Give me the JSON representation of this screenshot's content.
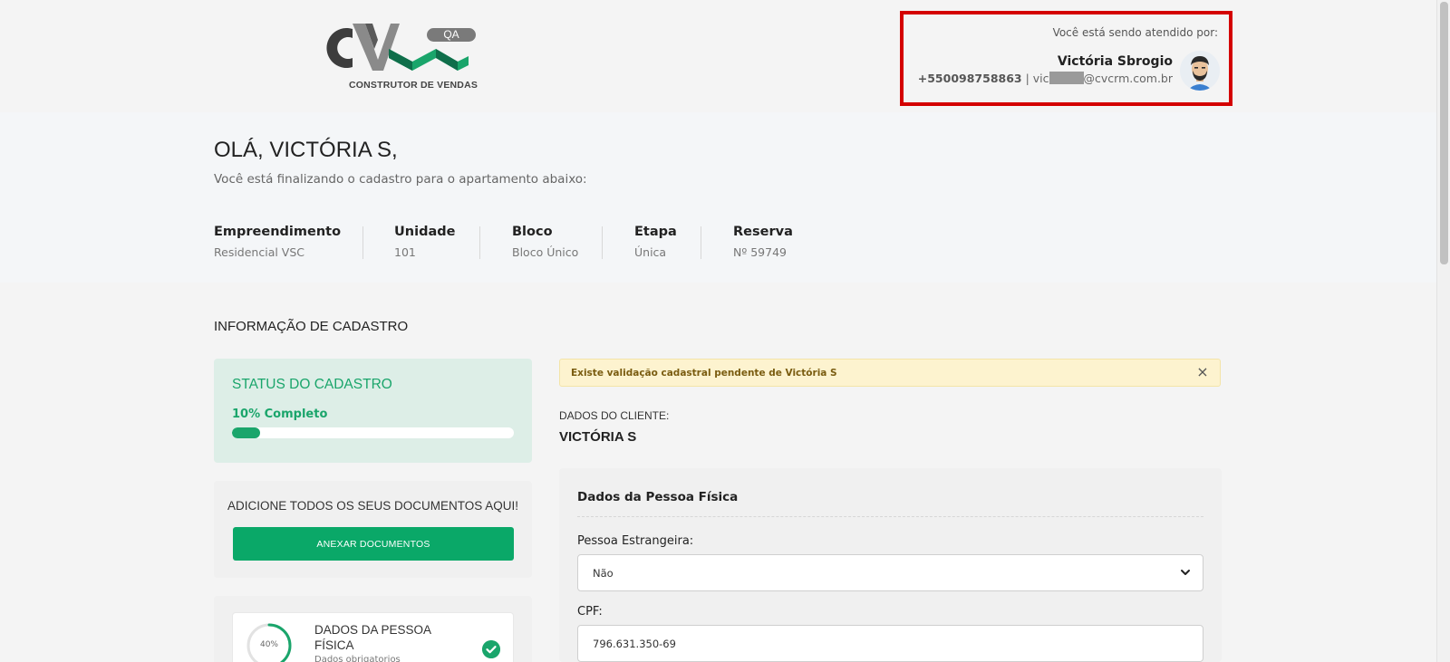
{
  "header": {
    "logo_badge": "QA",
    "logo_tagline": "CONSTRUTOR DE VENDAS",
    "attendant": {
      "label": "Você está sendo atendido por:",
      "name": "Victória Sbrogio",
      "phone": "+550098758863",
      "separator": " | ",
      "email_prefix": "vic",
      "email_suffix": "@cvcrm.com.br"
    }
  },
  "hero": {
    "greeting": "OLÁ, VICTÓRIA S,",
    "subtitle": "Você está finalizando o cadastro para o apartamento abaixo:",
    "info": [
      {
        "label": "Empreendimento",
        "value": "Residencial VSC"
      },
      {
        "label": "Unidade",
        "value": "101"
      },
      {
        "label": "Bloco",
        "value": "Bloco Único"
      },
      {
        "label": "Etapa",
        "value": "Única"
      },
      {
        "label": "Reserva",
        "value": "Nº 59749"
      }
    ]
  },
  "section_title": "INFORMAÇÃO DE CADASTRO",
  "status": {
    "title": "STATUS DO CADASTRO",
    "percent_label": "10% Completo",
    "progress": 0.1
  },
  "docs": {
    "title": "ADICIONE TODOS OS SEUS DOCUMENTOS AQUI!",
    "button_label": "ANEXAR DOCUMENTOS"
  },
  "steps": [
    {
      "ring_label": "40%",
      "progress": 0.4,
      "name": "DADOS DA PESSOA FÍSICA",
      "sub": "Dados obrigatorios"
    }
  ],
  "alert": {
    "text": "Existe validação cadastral pendente de Victória S",
    "close": "×"
  },
  "client": {
    "label": "DADOS DO CLIENTE:",
    "name": "VICTÓRIA S"
  },
  "form": {
    "title": "Dados da Pessoa Física",
    "foreign_label": "Pessoa Estrangeira:",
    "foreign_value": "Não",
    "cpf_label": "CPF:",
    "cpf_value": "796.631.350-69"
  },
  "colors": {
    "brand_green": "#1aa56b",
    "button_green": "#0aa868",
    "highlight_red": "#d40000",
    "alert_bg": "#fdf3cf"
  }
}
